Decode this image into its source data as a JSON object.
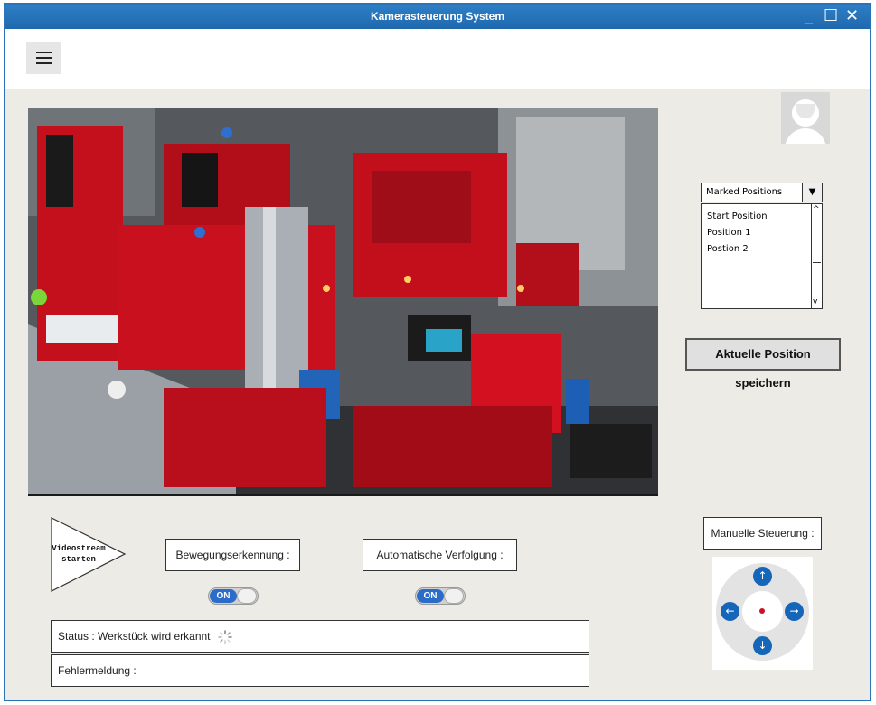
{
  "window": {
    "title": "Kamerasteuerung System",
    "minimize_glyph": "_",
    "maximize_glyph": "☐",
    "close_glyph": "✕"
  },
  "toolbar": {
    "menu_icon": "hamburger-menu-icon"
  },
  "video": {
    "content": "camera-feed-factory-model"
  },
  "user": {
    "avatar_icon": "user-avatar-icon"
  },
  "positions": {
    "dropdown_label": "Marked Positions",
    "dropdown_arrow": "▼",
    "items": [
      "Start Position",
      "Position 1",
      "Postion 2"
    ],
    "save_button": "Aktuelle Position speichern"
  },
  "controls": {
    "videostream_line1": "Videostream",
    "videostream_line2": "starten",
    "motion_label": "Bewegungserkennung :",
    "motion_toggle": "ON",
    "tracking_label": "Automatische Verfolgung :",
    "tracking_toggle": "ON"
  },
  "status": {
    "status_text": "Status : Werkstück wird erkannt",
    "error_text": "Fehlermeldung :"
  },
  "manual": {
    "label": "Manuelle Steuerung :",
    "up": "↑",
    "down": "↓",
    "left": "←",
    "right": "→"
  },
  "colors": {
    "titlebar": "#2b73b8",
    "background": "#ecebe5",
    "toggle_on": "#2a6cc7",
    "dpad_button": "#1566b8",
    "dpad_center_dot": "#d0102a"
  }
}
